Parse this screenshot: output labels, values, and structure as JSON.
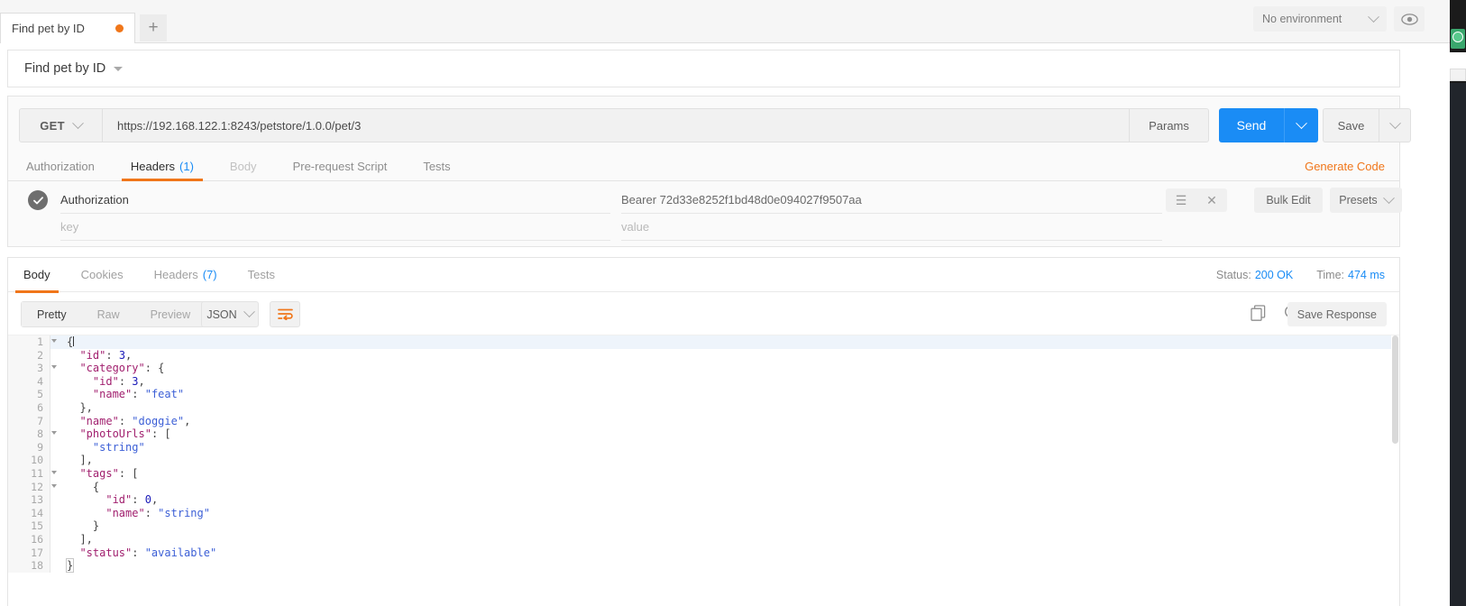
{
  "tabbar": {
    "request_tab_label": "Find pet by ID",
    "unsaved_dot": "unsaved-indicator",
    "new_tab_label": "+",
    "environment": "No environment",
    "eye_icon": "eye-icon"
  },
  "request_name": {
    "title": "Find pet by ID"
  },
  "request": {
    "method": "GET",
    "url": "https://192.168.122.1:8243/petstore/1.0.0/pet/3",
    "params_label": "Params",
    "send_label": "Send",
    "save_label": "Save",
    "generate_code_label": "Generate Code",
    "tabs": [
      {
        "label": "Authorization",
        "count": "",
        "state": "normal"
      },
      {
        "label": "Headers",
        "count": "(1)",
        "state": "active"
      },
      {
        "label": "Body",
        "count": "",
        "state": "dim"
      },
      {
        "label": "Pre-request Script",
        "count": "",
        "state": "normal"
      },
      {
        "label": "Tests",
        "count": "",
        "state": "normal"
      }
    ],
    "headers": {
      "rows": [
        {
          "key": "Authorization",
          "value": "Bearer 72d33e8252f1bd48d0e094027f9507aa",
          "checked": true
        },
        {
          "key": "key",
          "value": "value",
          "checked": false
        }
      ],
      "key_placeholder": "key",
      "value_placeholder": "value",
      "bulk_edit_label": "Bulk Edit",
      "presets_label": "Presets"
    }
  },
  "response": {
    "tabs": [
      {
        "label": "Body",
        "count": "",
        "state": "active"
      },
      {
        "label": "Cookies",
        "count": "",
        "state": "normal"
      },
      {
        "label": "Headers",
        "count": "(7)",
        "state": "normal"
      },
      {
        "label": "Tests",
        "count": "",
        "state": "normal"
      }
    ],
    "status_label": "Status:",
    "status_value": "200 OK",
    "time_label": "Time:",
    "time_value": "474 ms",
    "view_modes": [
      "Pretty",
      "Raw",
      "Preview"
    ],
    "active_view_mode": "Pretty",
    "format": "JSON",
    "wrap_icon": "word-wrap-icon",
    "copy_icon": "copy-icon",
    "search_icon": "search-icon",
    "save_response_label": "Save Response",
    "body_lines": [
      {
        "n": 1,
        "fold": true,
        "indent": 0,
        "tokens": [
          {
            "t": "p",
            "v": "{"
          }
        ],
        "caret": true,
        "highlight": true
      },
      {
        "n": 2,
        "fold": false,
        "indent": 1,
        "tokens": [
          {
            "t": "k",
            "v": "\"id\""
          },
          {
            "t": "p",
            "v": ": "
          },
          {
            "t": "n",
            "v": "3"
          },
          {
            "t": "p",
            "v": ","
          }
        ]
      },
      {
        "n": 3,
        "fold": true,
        "indent": 1,
        "tokens": [
          {
            "t": "k",
            "v": "\"category\""
          },
          {
            "t": "p",
            "v": ": {"
          }
        ]
      },
      {
        "n": 4,
        "fold": false,
        "indent": 2,
        "tokens": [
          {
            "t": "k",
            "v": "\"id\""
          },
          {
            "t": "p",
            "v": ": "
          },
          {
            "t": "n",
            "v": "3"
          },
          {
            "t": "p",
            "v": ","
          }
        ]
      },
      {
        "n": 5,
        "fold": false,
        "indent": 2,
        "tokens": [
          {
            "t": "k",
            "v": "\"name\""
          },
          {
            "t": "p",
            "v": ": "
          },
          {
            "t": "s",
            "v": "\"feat\""
          }
        ]
      },
      {
        "n": 6,
        "fold": false,
        "indent": 1,
        "tokens": [
          {
            "t": "p",
            "v": "},"
          }
        ]
      },
      {
        "n": 7,
        "fold": false,
        "indent": 1,
        "tokens": [
          {
            "t": "k",
            "v": "\"name\""
          },
          {
            "t": "p",
            "v": ": "
          },
          {
            "t": "s",
            "v": "\"doggie\""
          },
          {
            "t": "p",
            "v": ","
          }
        ]
      },
      {
        "n": 8,
        "fold": true,
        "indent": 1,
        "tokens": [
          {
            "t": "k",
            "v": "\"photoUrls\""
          },
          {
            "t": "p",
            "v": ": ["
          }
        ]
      },
      {
        "n": 9,
        "fold": false,
        "indent": 2,
        "tokens": [
          {
            "t": "s",
            "v": "\"string\""
          }
        ]
      },
      {
        "n": 10,
        "fold": false,
        "indent": 1,
        "tokens": [
          {
            "t": "p",
            "v": "],"
          }
        ]
      },
      {
        "n": 11,
        "fold": true,
        "indent": 1,
        "tokens": [
          {
            "t": "k",
            "v": "\"tags\""
          },
          {
            "t": "p",
            "v": ": ["
          }
        ]
      },
      {
        "n": 12,
        "fold": true,
        "indent": 2,
        "tokens": [
          {
            "t": "p",
            "v": "{"
          }
        ]
      },
      {
        "n": 13,
        "fold": false,
        "indent": 3,
        "tokens": [
          {
            "t": "k",
            "v": "\"id\""
          },
          {
            "t": "p",
            "v": ": "
          },
          {
            "t": "n",
            "v": "0"
          },
          {
            "t": "p",
            "v": ","
          }
        ]
      },
      {
        "n": 14,
        "fold": false,
        "indent": 3,
        "tokens": [
          {
            "t": "k",
            "v": "\"name\""
          },
          {
            "t": "p",
            "v": ": "
          },
          {
            "t": "s",
            "v": "\"string\""
          }
        ]
      },
      {
        "n": 15,
        "fold": false,
        "indent": 2,
        "tokens": [
          {
            "t": "p",
            "v": "}"
          }
        ]
      },
      {
        "n": 16,
        "fold": false,
        "indent": 1,
        "tokens": [
          {
            "t": "p",
            "v": "],"
          }
        ]
      },
      {
        "n": 17,
        "fold": false,
        "indent": 1,
        "tokens": [
          {
            "t": "k",
            "v": "\"status\""
          },
          {
            "t": "p",
            "v": ": "
          },
          {
            "t": "s",
            "v": "\"available\""
          }
        ]
      },
      {
        "n": 18,
        "fold": false,
        "indent": 0,
        "tokens": [
          {
            "t": "p",
            "v": "}"
          }
        ],
        "brace_match": true
      }
    ]
  },
  "colors": {
    "accent_orange": "#f0761a",
    "send_blue": "#1a8cf5",
    "link_blue": "#1a8cf5"
  }
}
